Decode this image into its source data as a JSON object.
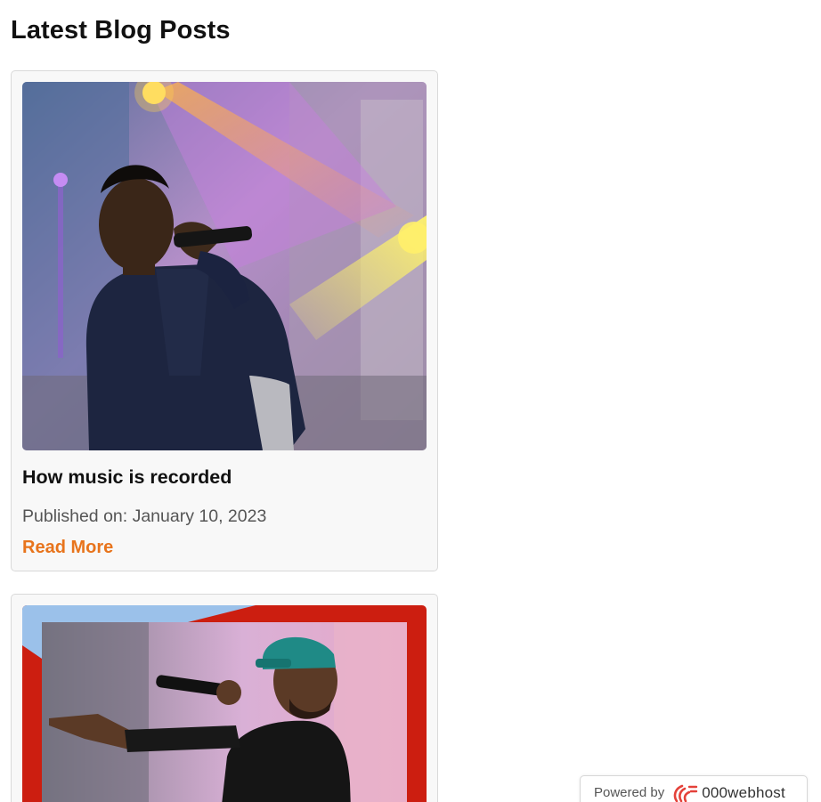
{
  "page": {
    "title": "Latest Blog Posts"
  },
  "posts": [
    {
      "image_alt": "Young man singing into a microphone on a stage with purple and yellow lights",
      "title": "How music is recorded",
      "published": "Published on: January 10, 2023",
      "read_more": "Read More"
    },
    {
      "image_alt": "Rapper in a green cap performing with a microphone in front of a red frame"
    }
  ],
  "footer_badge": {
    "powered_by": "Powered by",
    "brand": "000webhost",
    "brand_icon": "000webhost-logo-icon"
  },
  "colors": {
    "accent": "#e8741c",
    "card_bg": "#f8f8f8",
    "card_border": "#d9d9d9"
  }
}
